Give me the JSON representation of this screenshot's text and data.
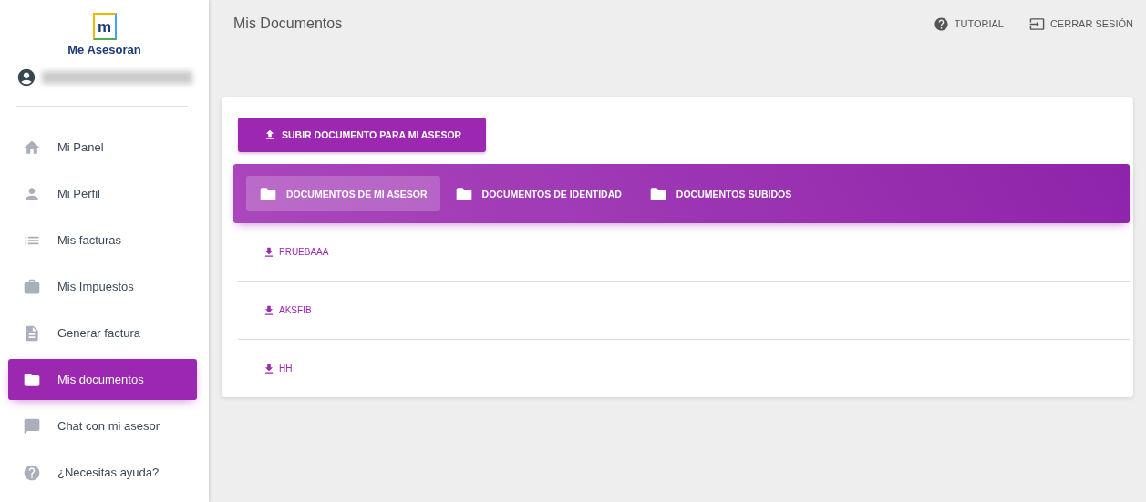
{
  "brand": {
    "logo_letter": "m",
    "name": "Me Asesoran"
  },
  "sidebar": {
    "items": [
      {
        "label": "Mi Panel",
        "selected": false
      },
      {
        "label": "Mi Perfil",
        "selected": false
      },
      {
        "label": "Mis facturas",
        "selected": false
      },
      {
        "label": "Mis Impuestos",
        "selected": false
      },
      {
        "label": "Generar factura",
        "selected": false
      },
      {
        "label": "Mis documentos",
        "selected": true
      },
      {
        "label": "Chat con mi asesor",
        "selected": false
      },
      {
        "label": "¿Necesitas ayuda?",
        "selected": false
      }
    ]
  },
  "header": {
    "title": "Mis Documentos",
    "actions": [
      "TUTORIAL",
      "CERRAR SESIÓN"
    ]
  },
  "upload_button": "SUBIR DOCUMENTO PARA MI ASESOR",
  "tabs": [
    {
      "label": "DOCUMENTOS DE MI ASESOR",
      "selected": true
    },
    {
      "label": "DOCUMENTOS DE IDENTIDAD",
      "selected": false
    },
    {
      "label": "DOCUMENTOS SUBIDOS",
      "selected": false
    }
  ],
  "documents": [
    "PRUEBAAA",
    "AKSFIB",
    "HH"
  ]
}
